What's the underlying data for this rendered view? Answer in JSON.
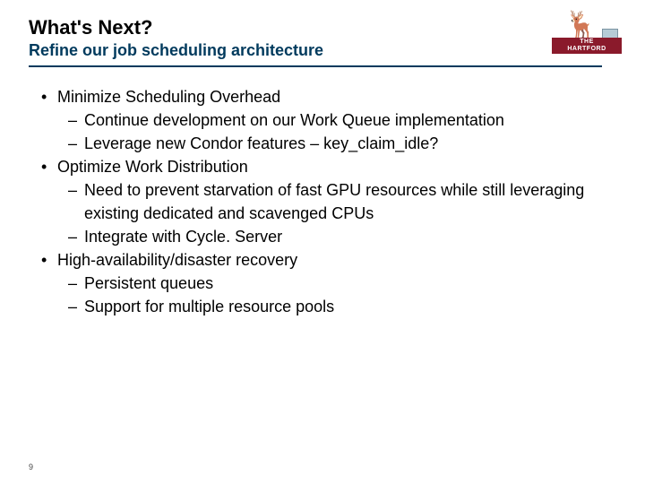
{
  "header": {
    "title": "What's Next?",
    "subtitle": "Refine our job scheduling architecture"
  },
  "logo": {
    "line1": "THE",
    "line2": "HARTFORD",
    "name": "the-hartford-logo"
  },
  "bullets": [
    {
      "text": "Minimize Scheduling Overhead",
      "sub": [
        "Continue development on our Work Queue implementation",
        "Leverage new Condor features – key_claim_idle?"
      ]
    },
    {
      "text": "Optimize Work Distribution",
      "sub": [
        "Need to prevent starvation of fast GPU resources while still leveraging existing dedicated and scavenged CPUs",
        "Integrate with Cycle. Server"
      ]
    },
    {
      "text": "High-availability/disaster recovery",
      "sub": [
        "Persistent queues",
        "Support for multiple resource pools"
      ]
    }
  ],
  "page_number": "9"
}
